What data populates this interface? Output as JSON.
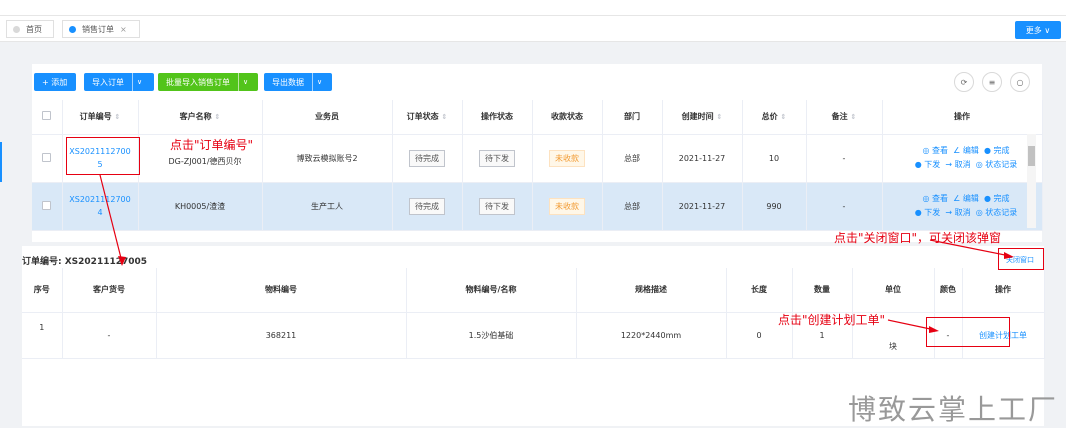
{
  "tabs": [
    {
      "label": "首页",
      "dot_color": "#d9d9d9"
    },
    {
      "label": "销售订单",
      "dot_color": "#1890ff",
      "close": "×"
    }
  ],
  "more_button": "更多 ∨",
  "toolbar": {
    "add": "+ 添加",
    "import_order": "导入订单",
    "batch_import": "批量导入销售订单",
    "export": "导出数据",
    "caret": "∨",
    "icons": {
      "refresh": "⟳",
      "columns": "≡",
      "search": "○"
    }
  },
  "orders_table": {
    "headers": [
      "订单编号",
      "客户名称",
      "业务员",
      "订单状态",
      "操作状态",
      "收款状态",
      "部门",
      "创建时间",
      "总价",
      "备注",
      "操作"
    ],
    "sort_icon": "⇕",
    "rows": [
      {
        "order_no": "XS2021112700\n5",
        "customer": "DG-ZJ001/德西贝尔",
        "salesman": "博致云模拟账号2",
        "order_status": "待完成",
        "op_status": "待下发",
        "pay_status": "未收款",
        "dept": "总部",
        "created": "2021-11-27",
        "total": "10",
        "remark": "-"
      },
      {
        "order_no": "XS2021112700\n4",
        "customer": "KH0005/渣渣",
        "salesman": "生产工人",
        "order_status": "待完成",
        "op_status": "待下发",
        "pay_status": "未收款",
        "dept": "总部",
        "created": "2021-11-27",
        "total": "990",
        "remark": "-"
      }
    ],
    "ops": {
      "view": "◎ 查看",
      "edit": "∠ 编辑",
      "done": "● 完成",
      "issue": "● 下发",
      "cancel": "→ 取消",
      "log": "◎ 状态记录"
    }
  },
  "detail": {
    "title": "订单编号: XS20211127005",
    "close_window": "关闭窗口",
    "headers": [
      "序号",
      "客户货号",
      "物料编号",
      "物料编号/名称",
      "规格描述",
      "长度",
      "数量",
      "单位",
      "颜色",
      "操作"
    ],
    "rows": [
      {
        "seq": "1",
        "cust_item": "-",
        "material_no": "368211",
        "material_name": "1.5沙伯基础",
        "spec": "1220*2440mm",
        "length": "0",
        "qty": "1",
        "unit": "块",
        "color": "-",
        "action": "创建计划工单"
      }
    ]
  },
  "annotations": {
    "a1": "点击\"订单编号\"",
    "a2": "点击\"关闭窗口\"，可关闭该弹窗",
    "a3": "点击\"创建计划工单\""
  },
  "watermark": "博致云掌上工厂"
}
